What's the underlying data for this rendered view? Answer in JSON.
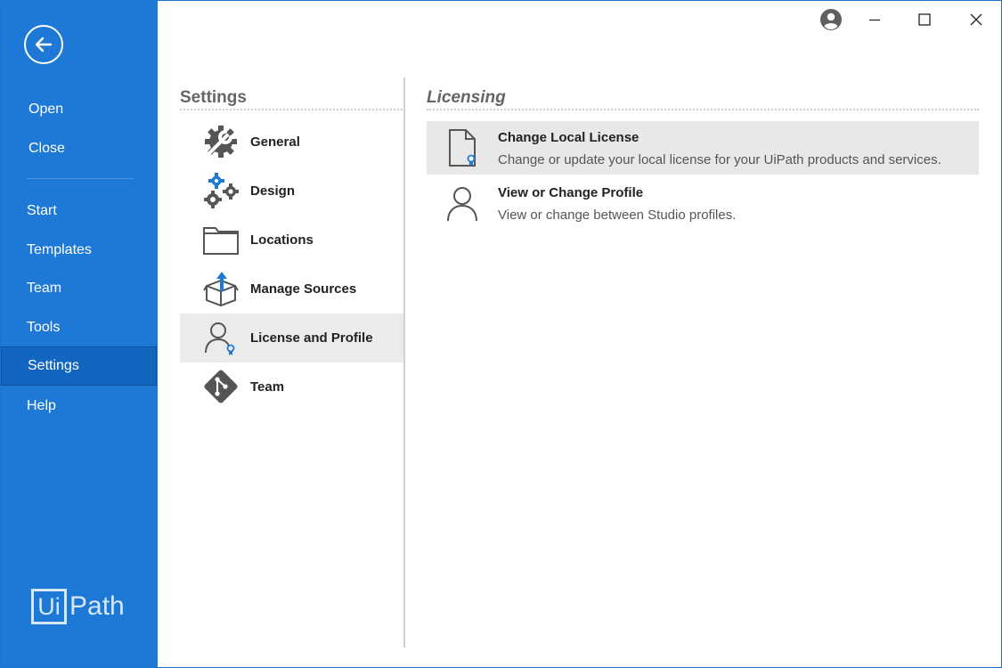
{
  "nav": {
    "top_items": [
      {
        "label": "Open"
      },
      {
        "label": "Close"
      }
    ],
    "items": [
      {
        "label": "Start"
      },
      {
        "label": "Templates"
      },
      {
        "label": "Team"
      },
      {
        "label": "Tools"
      },
      {
        "label": "Settings"
      },
      {
        "label": "Help"
      }
    ],
    "active": "Settings",
    "logo_box": "Ui",
    "logo_text": "Path"
  },
  "colors": {
    "nav_bg": "#1d78d6",
    "nav_active": "#1366bf",
    "accent_icon": "#1a7ad6"
  },
  "settings": {
    "title": "Settings",
    "items": [
      {
        "label": "General",
        "icon": "wrench-gear-icon"
      },
      {
        "label": "Design",
        "icon": "gears-icon"
      },
      {
        "label": "Locations",
        "icon": "folder-icon"
      },
      {
        "label": "Manage Sources",
        "icon": "package-upload-icon"
      },
      {
        "label": "License and Profile",
        "icon": "user-license-icon"
      },
      {
        "label": "Team",
        "icon": "git-icon"
      }
    ],
    "active": "License and Profile"
  },
  "licensing": {
    "title": "Licensing",
    "items": [
      {
        "name": "Change Local License",
        "desc": "Change or update your local license for your UiPath products and services.",
        "icon": "license-document-icon"
      },
      {
        "name": "View or Change Profile",
        "desc": "View or change between Studio profiles.",
        "icon": "user-icon"
      }
    ]
  }
}
